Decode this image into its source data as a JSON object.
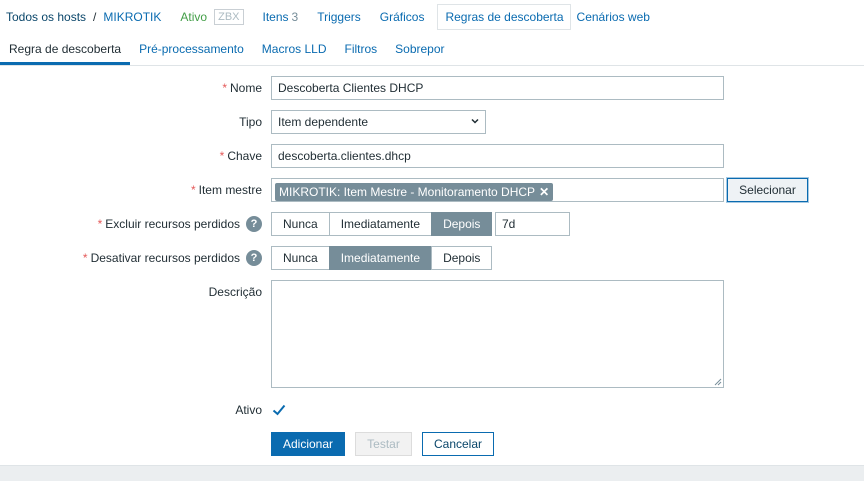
{
  "breadcrumb": {
    "all_hosts": "Todos os hosts",
    "separator": "/",
    "host": "MIKROTIK",
    "status": "Ativo",
    "availability": "ZBX"
  },
  "host_nav": {
    "items": {
      "label": "Itens",
      "count": "3"
    },
    "triggers": "Triggers",
    "graphs": "Gráficos",
    "discovery": "Regras de descoberta",
    "web": "Cenários web"
  },
  "tabs": [
    {
      "label": "Regra de descoberta",
      "active": true
    },
    {
      "label": "Pré-processamento",
      "active": false
    },
    {
      "label": "Macros LLD",
      "active": false
    },
    {
      "label": "Filtros",
      "active": false
    },
    {
      "label": "Sobrepor",
      "active": false
    }
  ],
  "form": {
    "required_mark": "*",
    "help_glyph": "?",
    "name": {
      "label": "Nome",
      "value": "Descoberta Clientes DHCP"
    },
    "type": {
      "label": "Tipo",
      "value": "Item dependente"
    },
    "key": {
      "label": "Chave",
      "value": "descoberta.clientes.dhcp"
    },
    "master_item": {
      "label": "Item mestre",
      "chip": "MIKROTIK: Item Mestre - Monitoramento DHCP",
      "chip_remove": "✕",
      "select_button": "Selecionar"
    },
    "delete_lost": {
      "label": "Excluir recursos perdidos",
      "options": [
        "Nunca",
        "Imediatamente",
        "Depois"
      ],
      "selected": "Depois",
      "period": "7d"
    },
    "disable_lost": {
      "label": "Desativar recursos perdidos",
      "options": [
        "Nunca",
        "Imediatamente",
        "Depois"
      ],
      "selected": "Imediatamente"
    },
    "description": {
      "label": "Descrição",
      "value": ""
    },
    "enabled": {
      "label": "Ativo",
      "checked": true
    }
  },
  "buttons": {
    "add": "Adicionar",
    "test": "Testar",
    "cancel": "Cancelar"
  },
  "colors": {
    "link": "#0a6bb0",
    "active_status": "#429e47",
    "required": "#e45959",
    "segment_selected": "#768d99"
  }
}
